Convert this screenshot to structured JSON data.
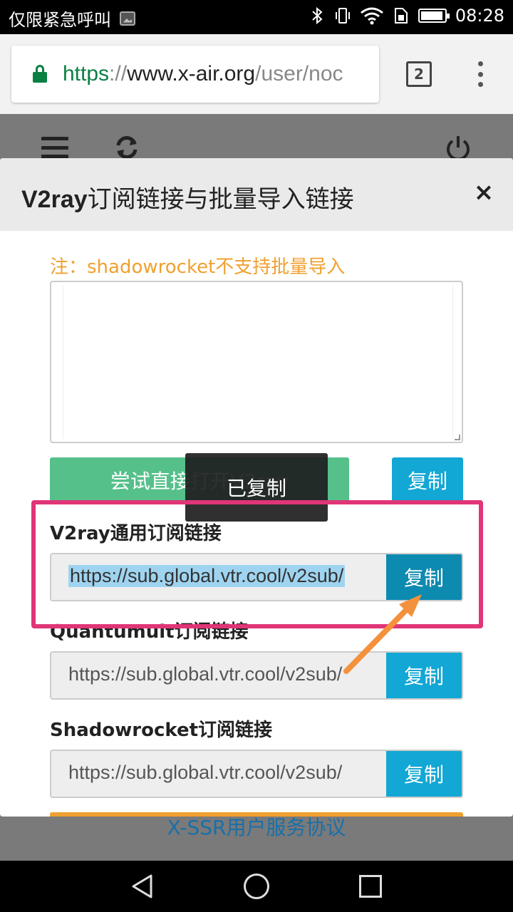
{
  "status_bar": {
    "carrier_text": "仅限紧急呼叫",
    "time": "08:28"
  },
  "browser": {
    "url_scheme": "https",
    "url_sep": "://",
    "url_host": "www.x-air.org",
    "url_path": "/user/noc",
    "tab_count": "2"
  },
  "modal": {
    "title_latin": "V2ray",
    "title_rest": "订阅链接与批量导入链接",
    "close": "×",
    "note": "注：shadowrocket不支持批量导入",
    "open_button": "尝试直接打开V2ray",
    "copy_button": "复制",
    "sections": [
      {
        "label": "V2ray通用订阅链接",
        "value": "https://sub.global.vtr.cool/v2sub/",
        "copy": "复制"
      },
      {
        "label": "Quantumult订阅链接",
        "value": "https://sub.global.vtr.cool/v2sub/",
        "copy": "复制"
      },
      {
        "label": "Shadowrocket订阅链接",
        "value": "https://sub.global.vtr.cool/v2sub/",
        "copy": "复制"
      }
    ]
  },
  "toast": "已复制",
  "footer_link": "X-SSR用户服务协议",
  "colors": {
    "highlight": "#e03576",
    "arrow": "#f4913c",
    "copy_blue": "#12a7d4",
    "open_green": "#55c08a",
    "note_orange": "#f0a030"
  }
}
